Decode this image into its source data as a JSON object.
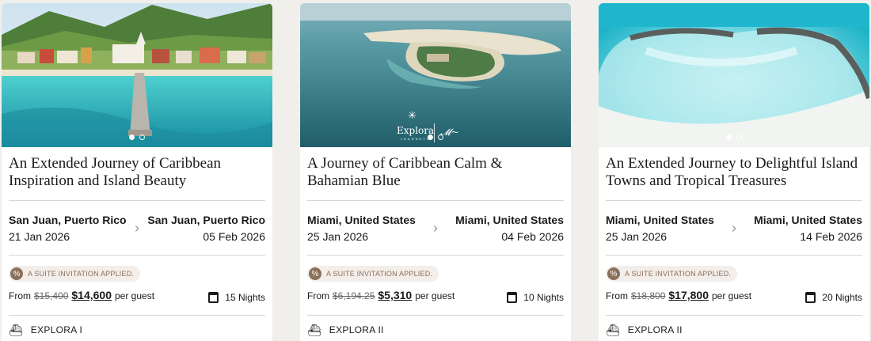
{
  "cards": [
    {
      "title": "An Extended Journey of Caribbean Inspiration and Island Beauty",
      "from_port": "San Juan, Puerto Rico",
      "from_date": "21 Jan 2026",
      "to_port": "San Juan, Puerto Rico",
      "to_date": "05 Feb 2026",
      "badge": "A SUITE INVITATION APPLIED.",
      "price_from": "From",
      "old_price": "$15,400",
      "new_price": "$14,600",
      "per_guest": "per guest",
      "nights": "15 Nights",
      "ship": "EXPLORA I"
    },
    {
      "title": "A Journey of Caribbean Calm & Bahamian Blue",
      "from_port": "Miami, United States",
      "from_date": "25 Jan 2026",
      "to_port": "Miami, United States",
      "to_date": "04 Feb 2026",
      "badge": "A SUITE INVITATION APPLIED.",
      "price_from": "From",
      "old_price": "$6,194.25",
      "new_price": "$5,310",
      "per_guest": "per guest",
      "nights": "10 Nights",
      "ship": "EXPLORA II",
      "brand_logo": "Explora",
      "brand_sub": "JOURNEYS"
    },
    {
      "title": "An Extended Journey to Delightful Island Towns and Tropical Treasures",
      "from_port": "Miami, United States",
      "from_date": "25 Jan 2026",
      "to_port": "Miami, United States",
      "to_date": "14 Feb 2026",
      "badge": "A SUITE INVITATION APPLIED.",
      "price_from": "From",
      "old_price": "$18,800",
      "new_price": "$17,800",
      "per_guest": "per guest",
      "nights": "20 Nights",
      "ship": "EXPLORA II"
    }
  ],
  "icons": {
    "chevron": "chevron-right-icon",
    "percent": "percent-icon",
    "calendar": "calendar-icon",
    "ship": "ship-icon"
  },
  "colors": {
    "page_bg": "#f1efec",
    "badge_accent": "#8a6f5a",
    "badge_bg": "#f3eeea"
  }
}
